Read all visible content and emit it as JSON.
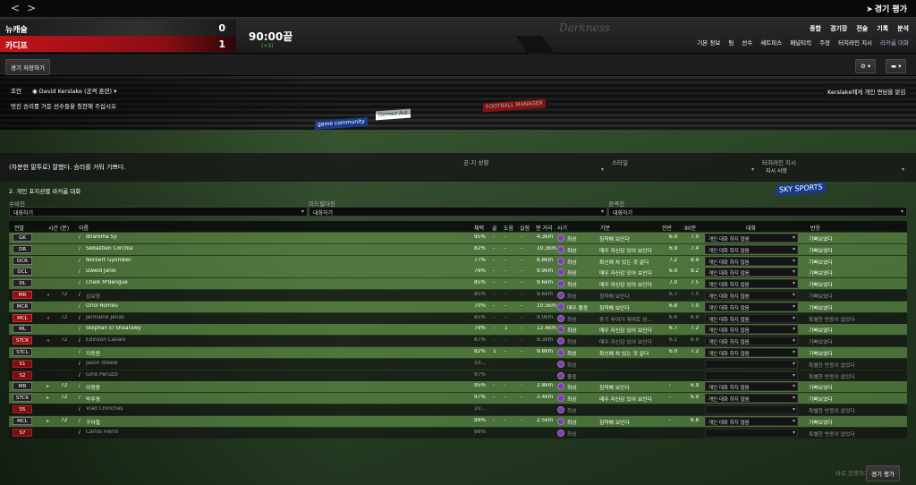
{
  "topbar": {
    "back": "<",
    "forward": ">",
    "continue": "경기 평가"
  },
  "score": {
    "home": "뉴캐슬",
    "home_score": "0",
    "away": "카디프",
    "away_score": "1",
    "clock": "90:00끝",
    "added": "(+3)"
  },
  "watermark": "Darkness",
  "menu_primary": [
    "종합",
    "경기장",
    "전술",
    "기록",
    "분석"
  ],
  "menu_secondary": [
    "기본 정보",
    "팀",
    "선수",
    "세트피스",
    "페널티킥",
    "주장",
    "터치라인 지시",
    "라커룸 대화"
  ],
  "toolbar": {
    "save": "경기 저장하기",
    "settings_icon": "gear-icon",
    "chat_icon": "chat-icon"
  },
  "advice": {
    "label": "조언",
    "coach": "David Kerslake (공격 훈련)",
    "text": "멋진 승리를 거둔 선수들을 칭찬해 주십시오",
    "button": "Kerslake에게 개인 면담을 맡김"
  },
  "team_talk": {
    "text": "(차분한 말투로) 잘했다. 승리를 거둬 기쁘다.",
    "tone_label": "공-지 성향",
    "style_label": "스타일",
    "touchline_label": "터치라인 지시",
    "touchline_value": "지시 사항"
  },
  "group": {
    "title": "2. 개인 포지션별 라커룸 대화",
    "def_label": "수비진",
    "def_value": "대화하기",
    "mid_label": "미드필더진",
    "mid_value": "대화하기",
    "att_label": "공격진",
    "att_value": "대화하기"
  },
  "columns": {
    "pos": "전발",
    "time": "시간 (분)",
    "name": "이름",
    "stamina": "체력",
    "goals": "골",
    "assists": "도움",
    "shots": "실점",
    "dist": "뛴 거리",
    "morale": "사기",
    "mood": "기분",
    "first_half": "전반",
    "full": "90분",
    "talk": "대화",
    "react": "반응"
  },
  "rows": [
    {
      "pos": "GK",
      "posType": "d",
      "on": true,
      "dim": false,
      "sub": false,
      "time": "",
      "name": "Ibrahima Sy",
      "stamina": "95%",
      "goals": "-",
      "assists": "-",
      "shots": "-",
      "dist": "4.3km",
      "morale": "최상",
      "mood": "침착해 보인다",
      "fh": "6.9",
      "ft": "7.0",
      "talk": "개인 대화 하지 않음",
      "react": "기뻐보였다"
    },
    {
      "pos": "DR",
      "posType": "d",
      "on": true,
      "dim": false,
      "sub": false,
      "time": "",
      "name": "Sébastien Corchia",
      "stamina": "82%",
      "goals": "-",
      "assists": "-",
      "shots": "-",
      "dist": "10.3km",
      "morale": "최상",
      "mood": "매우 자신감 있어 보인다",
      "fh": "6.9",
      "ft": "7.4",
      "talk": "개인 대화 하지 않음",
      "react": "기뻐보였다"
    },
    {
      "pos": "DCR",
      "posType": "d",
      "on": true,
      "dim": false,
      "sub": false,
      "time": "",
      "name": "Norbert Gyomber",
      "stamina": "77%",
      "goals": "-",
      "assists": "-",
      "shots": "-",
      "dist": "8.8km",
      "morale": "최상",
      "mood": "확신에 차 있는 것 같다",
      "fh": "7.2",
      "ft": "8.9",
      "talk": "개인 대화 하지 않음",
      "react": "기뻐보였다"
    },
    {
      "pos": "DCL",
      "posType": "d",
      "on": true,
      "dim": false,
      "sub": false,
      "time": "",
      "name": "Dawid Janik",
      "stamina": "79%",
      "goals": "-",
      "assists": "-",
      "shots": "-",
      "dist": "9.9km",
      "morale": "최상",
      "mood": "매우 자신감 있어 보인다",
      "fh": "6.9",
      "ft": "8.2",
      "talk": "개인 대화 하지 않음",
      "react": "기뻐보였다"
    },
    {
      "pos": "DL",
      "posType": "d",
      "on": true,
      "dim": false,
      "sub": false,
      "time": "",
      "name": "Cheik M'Bengué",
      "stamina": "85%",
      "goals": "-",
      "assists": "-",
      "shots": "-",
      "dist": "9.6km",
      "morale": "최상",
      "mood": "매우 자신감 있어 보인다",
      "fh": "7.0",
      "ft": "7.5",
      "talk": "개인 대화 하지 않음",
      "react": "기뻐보였다"
    },
    {
      "pos": "MR",
      "posType": "m",
      "on": false,
      "dim": true,
      "sub": true,
      "time": "72",
      "name": "김보경",
      "stamina": "85%",
      "goals": "-",
      "assists": "-",
      "shots": "-",
      "dist": "9.6km",
      "morale": "최상",
      "mood": "침착해 보인다",
      "fh": "6.7",
      "ft": "7.0",
      "talk": "개인 대화 하지 않음",
      "react": "기뻐보였다"
    },
    {
      "pos": "MCR",
      "posType": "d",
      "on": true,
      "dim": false,
      "sub": false,
      "time": "",
      "name": "Oriol Romeu",
      "stamina": "70%",
      "goals": "-",
      "assists": "-",
      "shots": "-",
      "dist": "10.5km",
      "morale": "매우 좋음",
      "mood": "침착해 보인다",
      "fh": "6.8",
      "ft": "7.0",
      "talk": "개인 대화 하지 않음",
      "react": "기뻐보였다"
    },
    {
      "pos": "MCL",
      "posType": "m",
      "on": false,
      "dim": true,
      "sub": true,
      "time": "72",
      "name": "Jermaine Jenas",
      "stamina": "85%",
      "goals": "-",
      "assists": "-",
      "shots": "-",
      "dist": "9.0km",
      "morale": "최상",
      "mood": "동기 부여가 제대로 된...",
      "fh": "6.6",
      "ft": "6.9",
      "talk": "개인 대화 하지 않음",
      "react": "특별한 반응이 없었다"
    },
    {
      "pos": "ML",
      "posType": "d",
      "on": true,
      "dim": false,
      "sub": false,
      "time": "",
      "name": "Stephan El Shaarawy",
      "stamina": "79%",
      "goals": "-",
      "assists": "1",
      "shots": "-",
      "dist": "12.4km",
      "morale": "최상",
      "mood": "매우 자신감 있어 보인다",
      "fh": "6.7",
      "ft": "7.2",
      "talk": "개인 대화 하지 않음",
      "react": "기뻐보였다"
    },
    {
      "pos": "STCR",
      "posType": "m",
      "on": false,
      "dim": true,
      "sub": true,
      "time": "72",
      "name": "Edinson Cavani",
      "stamina": "87%",
      "goals": "-",
      "assists": "-",
      "shots": "-",
      "dist": "8.3km",
      "morale": "최상",
      "mood": "매우 자신감 있어 보인다",
      "fh": "6.1",
      "ft": "6.9",
      "talk": "개인 대화 하지 않음",
      "react": "기뻐보였다"
    },
    {
      "pos": "STCL",
      "posType": "d",
      "on": true,
      "dim": false,
      "sub": false,
      "time": "",
      "name": "지동원",
      "stamina": "82%",
      "goals": "1",
      "assists": "-",
      "shots": "-",
      "dist": "9.8km",
      "morale": "최상",
      "mood": "확신에 차 있는 것 같다",
      "fh": "6.0",
      "ft": "7.2",
      "talk": "개인 대화 하지 않음",
      "react": "기뻐보였다"
    },
    {
      "pos": "S1",
      "posType": "s",
      "on": false,
      "dim": true,
      "sub": false,
      "time": "",
      "name": "Jason Steele",
      "stamina": "10...",
      "goals": "",
      "assists": "",
      "shots": "",
      "dist": "",
      "morale": "최상",
      "mood": "",
      "fh": "",
      "ft": "",
      "talk": "",
      "react": "특별한 반응이 없었다"
    },
    {
      "pos": "S2",
      "posType": "s",
      "on": false,
      "dim": true,
      "sub": false,
      "time": "",
      "name": "Gino Peruzzi",
      "stamina": "97%",
      "goals": "",
      "assists": "",
      "shots": "",
      "dist": "",
      "morale": "좋음",
      "mood": "",
      "fh": "",
      "ft": "",
      "talk": "",
      "react": "특별한 반응이 없었다"
    },
    {
      "pos": "MR",
      "posType": "d",
      "on": true,
      "dim": false,
      "sub": true,
      "time": "72",
      "name": "이청용",
      "stamina": "95%",
      "goals": "-",
      "assists": "-",
      "shots": "-",
      "dist": "2.8km",
      "morale": "최상",
      "mood": "침착해 보인다",
      "fh": "-",
      "ft": "6.9",
      "talk": "개인 대화 하지 않음",
      "react": "기뻐보였다"
    },
    {
      "pos": "STCR",
      "posType": "d",
      "on": true,
      "dim": false,
      "sub": true,
      "time": "72",
      "name": "박주영",
      "stamina": "97%",
      "goals": "-",
      "assists": "-",
      "shots": "-",
      "dist": "2.4km",
      "morale": "최상",
      "mood": "매우 자신감 있어 보인다",
      "fh": "-",
      "ft": "6.9",
      "talk": "개인 대화 하지 않음",
      "react": "기뻐보였다"
    },
    {
      "pos": "S5",
      "posType": "s",
      "on": false,
      "dim": true,
      "sub": false,
      "time": "",
      "name": "Vlad Chiricheș",
      "stamina": "10...",
      "goals": "",
      "assists": "",
      "shots": "",
      "dist": "",
      "morale": "최상",
      "mood": "",
      "fh": "",
      "ft": "",
      "talk": "",
      "react": "특별한 반응이 없었다"
    },
    {
      "pos": "MCL",
      "posType": "d",
      "on": true,
      "dim": false,
      "sub": true,
      "time": "72",
      "name": "구자철",
      "stamina": "99%",
      "goals": "-",
      "assists": "-",
      "shots": "-",
      "dist": "2.5km",
      "morale": "최상",
      "mood": "침착해 보인다",
      "fh": "-",
      "ft": "6.8",
      "talk": "개인 대화 하지 않음",
      "react": "기뻐보였다"
    },
    {
      "pos": "S7",
      "posType": "s",
      "on": false,
      "dim": true,
      "sub": false,
      "time": "",
      "name": "Carlos Fierro",
      "stamina": "99%",
      "goals": "",
      "assists": "",
      "shots": "",
      "dist": "",
      "morale": "최상",
      "mood": "",
      "fh": "",
      "ft": "",
      "talk": "",
      "react": "특별한 반응이 없었다"
    }
  ],
  "footer": {
    "hint": "바로 진행하기",
    "button": "경기 평가"
  },
  "ads": [
    "Gomez Aid",
    "FOOTBALL MANAGER",
    "SKY SPORTS",
    "game community"
  ]
}
